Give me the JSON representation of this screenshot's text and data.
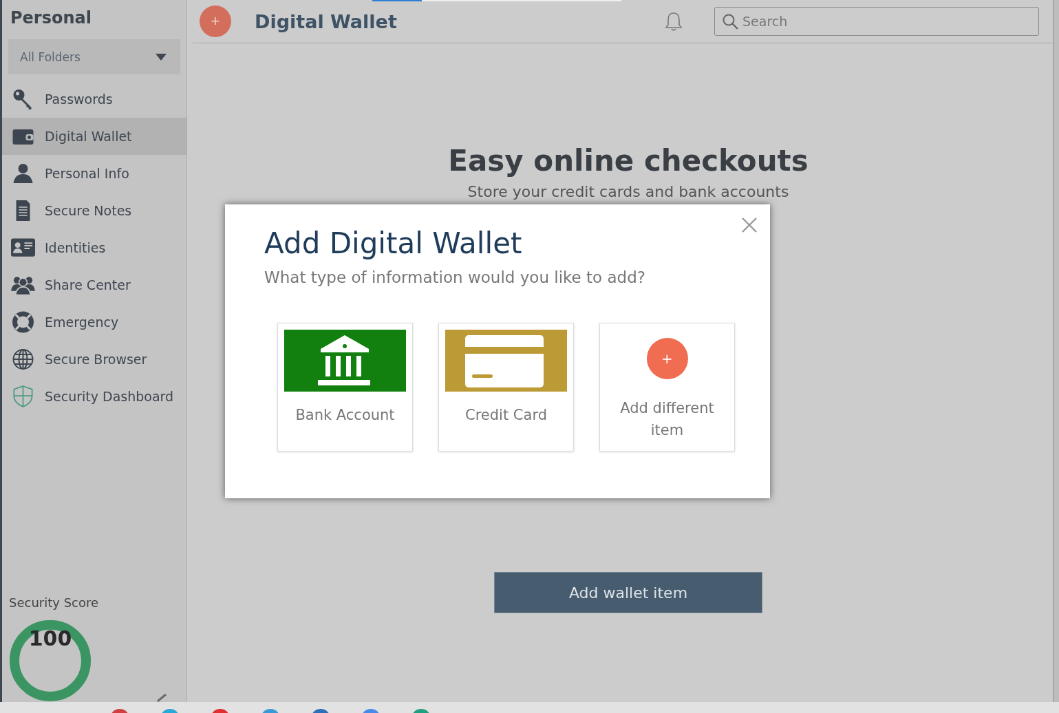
{
  "sidebar": {
    "title": "Personal",
    "folder_select": {
      "value": "All Folders"
    },
    "items": [
      {
        "label": "Passwords",
        "selected": false
      },
      {
        "label": "Digital Wallet",
        "selected": true
      },
      {
        "label": "Personal Info",
        "selected": false
      },
      {
        "label": "Secure Notes",
        "selected": false
      },
      {
        "label": "Identities",
        "selected": false
      },
      {
        "label": "Share Center",
        "selected": false
      },
      {
        "label": "Emergency",
        "selected": false
      },
      {
        "label": "Secure Browser",
        "selected": false
      },
      {
        "label": "Security Dashboard",
        "selected": false
      }
    ],
    "security_score": {
      "label": "Security Score",
      "value": "100",
      "level": 1
    }
  },
  "header": {
    "add_button": "+",
    "title": "Digital Wallet",
    "search": {
      "placeholder": "Search"
    }
  },
  "empty_state": {
    "heading": "Easy online checkouts",
    "subheading": "Store your credit cards and bank accounts",
    "button": "Add wallet item"
  },
  "dialog": {
    "title": "Add Digital Wallet",
    "prompt": "What type of information would you like to add?",
    "options": [
      {
        "label": "Bank Account",
        "kind": "bank"
      },
      {
        "label": "Credit Card",
        "kind": "card"
      },
      {
        "label": "Add different item",
        "kind": "add",
        "symbol": "+"
      }
    ]
  }
}
